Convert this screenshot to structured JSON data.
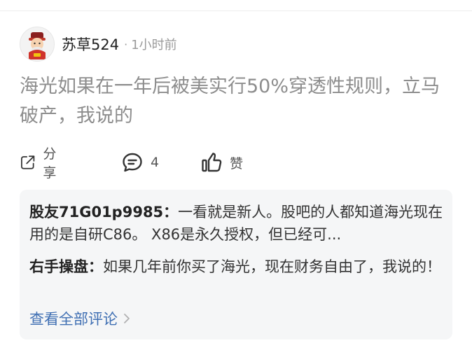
{
  "post": {
    "author": "苏草524",
    "separator": "·",
    "time": "1小时前",
    "text": "海光如果在一年后被美实行50%穿透性规则，立马破产，我说的"
  },
  "actions": {
    "share_label": "分享",
    "comment_count": "4",
    "like_label": "赞"
  },
  "comments": [
    {
      "author": "股友71G01p9985：",
      "text": "一看就是新人。股吧的人都知道海光现在用的是自研C86。 X86是永久授权，但已经可..."
    },
    {
      "author": "右手操盘：",
      "text": "如果几年前你买了海光，现在财务自由了，我说的！"
    }
  ],
  "view_all": "查看全部评论",
  "icons": {
    "share": "share-icon",
    "comment": "comment-icon",
    "like": "thumbs-up-icon",
    "chevron": "chevron-right-icon",
    "avatar": "caishen-avatar"
  },
  "colors": {
    "link": "#3f6fb3",
    "post_text": "#8d8d8d",
    "comment_bg": "#f5f6f7"
  }
}
